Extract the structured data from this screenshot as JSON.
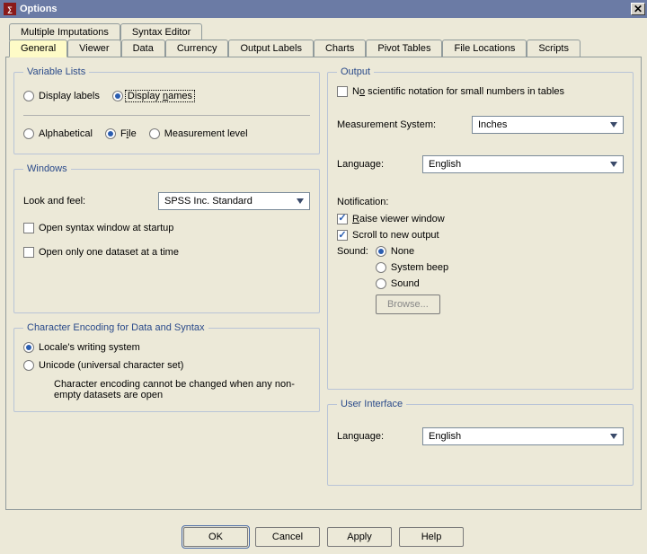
{
  "window": {
    "title": "Options"
  },
  "tabs_row1": [
    "Multiple Imputations",
    "Syntax Editor"
  ],
  "tabs_row2": [
    "General",
    "Viewer",
    "Data",
    "Currency",
    "Output Labels",
    "Charts",
    "Pivot Tables",
    "File Locations",
    "Scripts"
  ],
  "active_tab_row2_index": 0,
  "variable_lists": {
    "legend": "Variable Lists",
    "display_labels": "Display labels",
    "display_names_pre": "Display ",
    "display_names_u": "n",
    "display_names_post": "ames",
    "alphabetical": "Alphabetical",
    "file_pre": "F",
    "file_u": "i",
    "file_post": "le",
    "measurement_level": "Measurement level",
    "display_selected": "names",
    "order_selected": "file"
  },
  "windows": {
    "legend": "Windows",
    "look_and_feel": "Look and feel:",
    "look_and_feel_value": "SPSS Inc. Standard",
    "open_syntax": "Open syntax window at startup",
    "open_one": "Open only one dataset at a time",
    "open_syntax_checked": false,
    "open_one_checked": false
  },
  "encoding": {
    "legend": "Character Encoding for Data and Syntax",
    "locale": "Locale's writing system",
    "unicode": "Unicode (universal character set)",
    "note": "Character encoding cannot be changed when any non-empty datasets are open",
    "selected": "locale"
  },
  "output": {
    "legend": "Output",
    "no_sci_pre": "N",
    "no_sci_u": "o",
    "no_sci_post": " scientific notation for small numbers in tables",
    "no_sci_checked": false,
    "measurement_system": "Measurement System:",
    "measurement_system_value": "Inches",
    "language": "Language:",
    "language_value": "English",
    "notification": "Notification:",
    "raise_pre": "",
    "raise_u": "R",
    "raise_post": "aise viewer window",
    "raise_checked": true,
    "scroll": "Scroll to new output",
    "scroll_checked": true,
    "sound_label": "Sound:",
    "sound_none": "None",
    "sound_beep": "System beep",
    "sound_sound": "Sound",
    "sound_selected": "none",
    "browse": "Browse..."
  },
  "ui": {
    "legend": "User Interface",
    "language": "Language:",
    "language_value": "English"
  },
  "buttons": {
    "ok": "OK",
    "cancel": "Cancel",
    "apply": "Apply",
    "help": "Help"
  }
}
